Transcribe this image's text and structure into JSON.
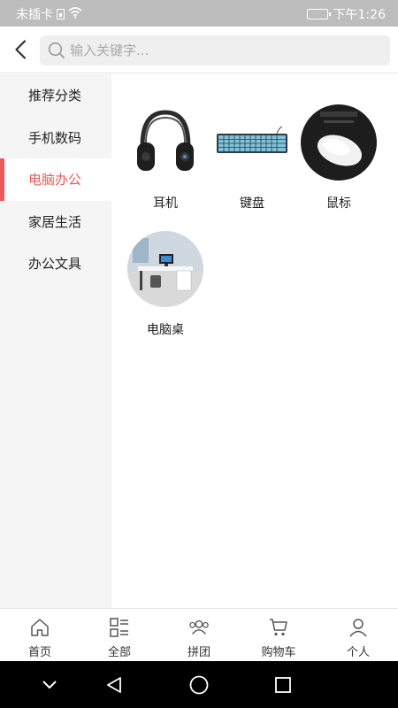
{
  "status_bar": {
    "carrier": "未插卡",
    "time": "下午1:26",
    "icons": [
      "sim-icon",
      "wifi-icon",
      "battery-icon"
    ]
  },
  "header": {
    "back_icon": "chevron-left-icon",
    "search": {
      "placeholder": "输入关键字...",
      "value": "",
      "icon": "search-icon"
    }
  },
  "sidebar": {
    "items": [
      {
        "label": "推荐分类",
        "active": false
      },
      {
        "label": "手机数码",
        "active": false
      },
      {
        "label": "电脑办公",
        "active": true
      },
      {
        "label": "家居生活",
        "active": false
      },
      {
        "label": "办公文具",
        "active": false
      }
    ],
    "active_color": "#ee5a5a"
  },
  "categories": [
    {
      "label": "耳机",
      "image": "headphones-image"
    },
    {
      "label": "键盘",
      "image": "keyboard-image"
    },
    {
      "label": "鼠标",
      "image": "mouse-image"
    },
    {
      "label": "电脑桌",
      "image": "computer-desk-image"
    }
  ],
  "tabbar": {
    "items": [
      {
        "label": "首页",
        "icon": "home-icon"
      },
      {
        "label": "全部",
        "icon": "list-icon"
      },
      {
        "label": "拼团",
        "icon": "group-icon"
      },
      {
        "label": "购物车",
        "icon": "cart-icon"
      },
      {
        "label": "个人",
        "icon": "user-icon"
      }
    ]
  },
  "system_nav": {
    "buttons": [
      "collapse-icon",
      "back-triangle-icon",
      "home-circle-icon",
      "recents-square-icon"
    ]
  }
}
